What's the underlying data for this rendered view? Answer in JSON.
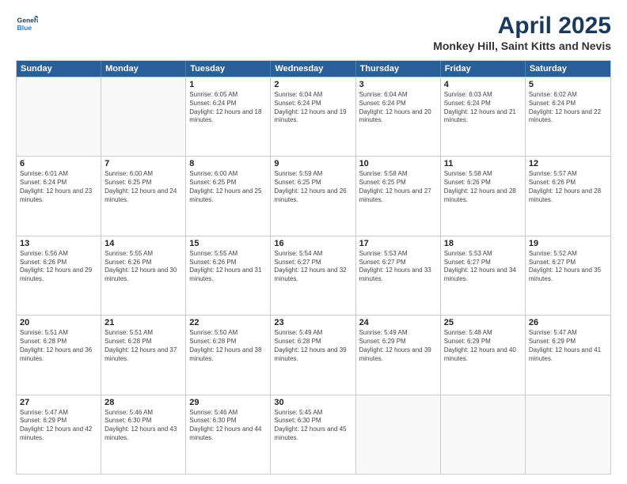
{
  "header": {
    "logo_line1": "General",
    "logo_line2": "Blue",
    "title": "April 2025",
    "subtitle": "Monkey Hill, Saint Kitts and Nevis"
  },
  "weekdays": [
    "Sunday",
    "Monday",
    "Tuesday",
    "Wednesday",
    "Thursday",
    "Friday",
    "Saturday"
  ],
  "rows": [
    [
      {
        "day": "",
        "empty": true
      },
      {
        "day": "",
        "empty": true
      },
      {
        "day": "1",
        "sunrise": "Sunrise: 6:05 AM",
        "sunset": "Sunset: 6:24 PM",
        "daylight": "Daylight: 12 hours and 18 minutes."
      },
      {
        "day": "2",
        "sunrise": "Sunrise: 6:04 AM",
        "sunset": "Sunset: 6:24 PM",
        "daylight": "Daylight: 12 hours and 19 minutes."
      },
      {
        "day": "3",
        "sunrise": "Sunrise: 6:04 AM",
        "sunset": "Sunset: 6:24 PM",
        "daylight": "Daylight: 12 hours and 20 minutes."
      },
      {
        "day": "4",
        "sunrise": "Sunrise: 6:03 AM",
        "sunset": "Sunset: 6:24 PM",
        "daylight": "Daylight: 12 hours and 21 minutes."
      },
      {
        "day": "5",
        "sunrise": "Sunrise: 6:02 AM",
        "sunset": "Sunset: 6:24 PM",
        "daylight": "Daylight: 12 hours and 22 minutes."
      }
    ],
    [
      {
        "day": "6",
        "sunrise": "Sunrise: 6:01 AM",
        "sunset": "Sunset: 6:24 PM",
        "daylight": "Daylight: 12 hours and 23 minutes."
      },
      {
        "day": "7",
        "sunrise": "Sunrise: 6:00 AM",
        "sunset": "Sunset: 6:25 PM",
        "daylight": "Daylight: 12 hours and 24 minutes."
      },
      {
        "day": "8",
        "sunrise": "Sunrise: 6:00 AM",
        "sunset": "Sunset: 6:25 PM",
        "daylight": "Daylight: 12 hours and 25 minutes."
      },
      {
        "day": "9",
        "sunrise": "Sunrise: 5:59 AM",
        "sunset": "Sunset: 6:25 PM",
        "daylight": "Daylight: 12 hours and 26 minutes."
      },
      {
        "day": "10",
        "sunrise": "Sunrise: 5:58 AM",
        "sunset": "Sunset: 6:25 PM",
        "daylight": "Daylight: 12 hours and 27 minutes."
      },
      {
        "day": "11",
        "sunrise": "Sunrise: 5:58 AM",
        "sunset": "Sunset: 6:26 PM",
        "daylight": "Daylight: 12 hours and 28 minutes."
      },
      {
        "day": "12",
        "sunrise": "Sunrise: 5:57 AM",
        "sunset": "Sunset: 6:26 PM",
        "daylight": "Daylight: 12 hours and 28 minutes."
      }
    ],
    [
      {
        "day": "13",
        "sunrise": "Sunrise: 5:56 AM",
        "sunset": "Sunset: 6:26 PM",
        "daylight": "Daylight: 12 hours and 29 minutes."
      },
      {
        "day": "14",
        "sunrise": "Sunrise: 5:55 AM",
        "sunset": "Sunset: 6:26 PM",
        "daylight": "Daylight: 12 hours and 30 minutes."
      },
      {
        "day": "15",
        "sunrise": "Sunrise: 5:55 AM",
        "sunset": "Sunset: 6:26 PM",
        "daylight": "Daylight: 12 hours and 31 minutes."
      },
      {
        "day": "16",
        "sunrise": "Sunrise: 5:54 AM",
        "sunset": "Sunset: 6:27 PM",
        "daylight": "Daylight: 12 hours and 32 minutes."
      },
      {
        "day": "17",
        "sunrise": "Sunrise: 5:53 AM",
        "sunset": "Sunset: 6:27 PM",
        "daylight": "Daylight: 12 hours and 33 minutes."
      },
      {
        "day": "18",
        "sunrise": "Sunrise: 5:53 AM",
        "sunset": "Sunset: 6:27 PM",
        "daylight": "Daylight: 12 hours and 34 minutes."
      },
      {
        "day": "19",
        "sunrise": "Sunrise: 5:52 AM",
        "sunset": "Sunset: 6:27 PM",
        "daylight": "Daylight: 12 hours and 35 minutes."
      }
    ],
    [
      {
        "day": "20",
        "sunrise": "Sunrise: 5:51 AM",
        "sunset": "Sunset: 6:28 PM",
        "daylight": "Daylight: 12 hours and 36 minutes."
      },
      {
        "day": "21",
        "sunrise": "Sunrise: 5:51 AM",
        "sunset": "Sunset: 6:28 PM",
        "daylight": "Daylight: 12 hours and 37 minutes."
      },
      {
        "day": "22",
        "sunrise": "Sunrise: 5:50 AM",
        "sunset": "Sunset: 6:28 PM",
        "daylight": "Daylight: 12 hours and 38 minutes."
      },
      {
        "day": "23",
        "sunrise": "Sunrise: 5:49 AM",
        "sunset": "Sunset: 6:28 PM",
        "daylight": "Daylight: 12 hours and 39 minutes."
      },
      {
        "day": "24",
        "sunrise": "Sunrise: 5:49 AM",
        "sunset": "Sunset: 6:29 PM",
        "daylight": "Daylight: 12 hours and 39 minutes."
      },
      {
        "day": "25",
        "sunrise": "Sunrise: 5:48 AM",
        "sunset": "Sunset: 6:29 PM",
        "daylight": "Daylight: 12 hours and 40 minutes."
      },
      {
        "day": "26",
        "sunrise": "Sunrise: 5:47 AM",
        "sunset": "Sunset: 6:29 PM",
        "daylight": "Daylight: 12 hours and 41 minutes."
      }
    ],
    [
      {
        "day": "27",
        "sunrise": "Sunrise: 5:47 AM",
        "sunset": "Sunset: 6:29 PM",
        "daylight": "Daylight: 12 hours and 42 minutes."
      },
      {
        "day": "28",
        "sunrise": "Sunrise: 5:46 AM",
        "sunset": "Sunset: 6:30 PM",
        "daylight": "Daylight: 12 hours and 43 minutes."
      },
      {
        "day": "29",
        "sunrise": "Sunrise: 5:46 AM",
        "sunset": "Sunset: 6:30 PM",
        "daylight": "Daylight: 12 hours and 44 minutes."
      },
      {
        "day": "30",
        "sunrise": "Sunrise: 5:45 AM",
        "sunset": "Sunset: 6:30 PM",
        "daylight": "Daylight: 12 hours and 45 minutes."
      },
      {
        "day": "",
        "empty": true
      },
      {
        "day": "",
        "empty": true
      },
      {
        "day": "",
        "empty": true
      }
    ]
  ]
}
